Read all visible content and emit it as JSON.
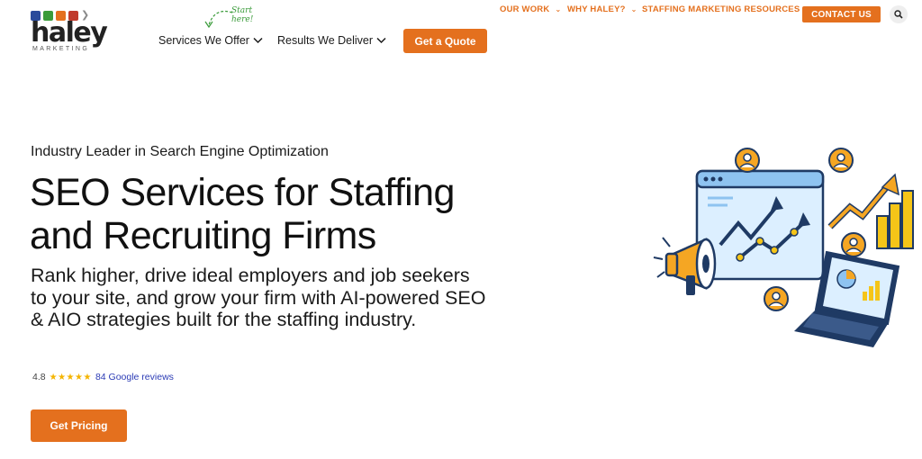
{
  "brand": {
    "name": "haley",
    "tagline": "MARKETING",
    "icon_colors": [
      "#2a4b9b",
      "#3a9b3a",
      "#e4701e",
      "#c0392b"
    ]
  },
  "utility_nav": {
    "items": [
      {
        "label": "OUR WORK",
        "icon": "chevron-down-icon"
      },
      {
        "label": "WHY HALEY?",
        "icon": "chevron-down-icon"
      },
      {
        "label": "STAFFING MARKETING RESOURCES",
        "icon": "chevron-down-icon"
      }
    ],
    "contact_label": "CONTACT US",
    "search_icon": "search-icon"
  },
  "main_nav": {
    "items": [
      {
        "label": "Services We Offer",
        "icon": "caret-down-icon"
      },
      {
        "label": "Results We Deliver",
        "icon": "caret-down-icon"
      }
    ],
    "quote_label": "Get a Quote",
    "annotation": "Start here!"
  },
  "hero": {
    "eyebrow": "Industry Leader in Search Engine Optimization",
    "headline_line1": "SEO Services for Staffing",
    "headline_line2": "and Recruiting Firms",
    "subhead": "Rank higher, drive ideal employers and job seekers to your site, and grow your firm with AI-powered SEO & AIO strategies built for the staffing industry.",
    "rating": {
      "score": "4.8",
      "stars": "★★★★★",
      "star_count": 5,
      "reviews_label": "84 Google reviews"
    },
    "cta_label": "Get Pricing"
  },
  "colors": {
    "accent": "#e4701e",
    "navy": "#1f3a64",
    "link": "#2b3bb5",
    "star": "#f4b400",
    "annotation_green": "#3a9b3a",
    "illustration_light_blue": "#dcefff"
  }
}
